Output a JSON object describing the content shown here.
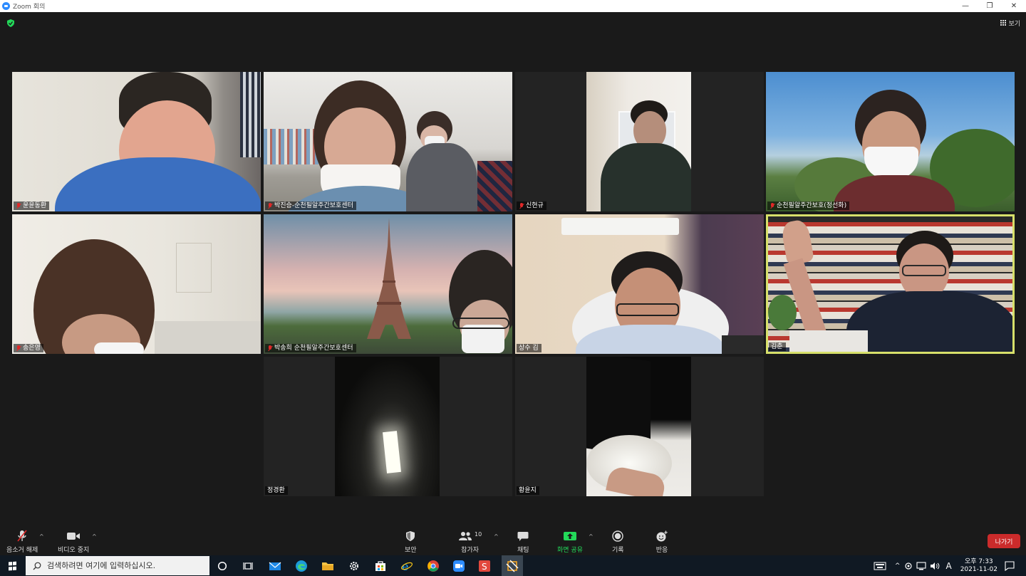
{
  "window": {
    "title": "Zoom 회의",
    "minimize": "—",
    "restore": "❐",
    "close": "✕"
  },
  "meeting": {
    "view_label": "보기",
    "participants_tiles": [
      {
        "name": "윤윤동환",
        "muted": true
      },
      {
        "name": "박진승-순천필알주간보호센터",
        "muted": true
      },
      {
        "name": "신현규",
        "muted": true
      },
      {
        "name": "순천필알주간보호(정선화)",
        "muted": true
      },
      {
        "name": "송은영",
        "muted": true
      },
      {
        "name": "박송희 순천필알주간보호센터",
        "muted": true
      },
      {
        "name": "상수 김",
        "muted": false
      },
      {
        "name": "김춘",
        "muted": false,
        "active_speaker": true
      },
      {
        "name": "정경환",
        "muted": false
      },
      {
        "name": "황윤지",
        "muted": false
      }
    ]
  },
  "toolbar": {
    "unmute_label": "음소거 해제",
    "stop_video_label": "비디오 중지",
    "security_label": "보안",
    "participants_label": "참가자",
    "participants_count": "10",
    "chat_label": "채팅",
    "share_screen_label": "화면 공유",
    "record_label": "기록",
    "reactions_label": "반응",
    "leave_label": "나가기",
    "colors": {
      "share_green": "#23d959",
      "leave_red": "#cb2b2b",
      "active_speaker": "#d7e06a"
    }
  },
  "taskbar": {
    "search_placeholder": "검색하려면 여기에 입력하십시오.",
    "clock_time": "오후 7:33",
    "clock_date": "2021-11-02",
    "ime_label": "A"
  }
}
